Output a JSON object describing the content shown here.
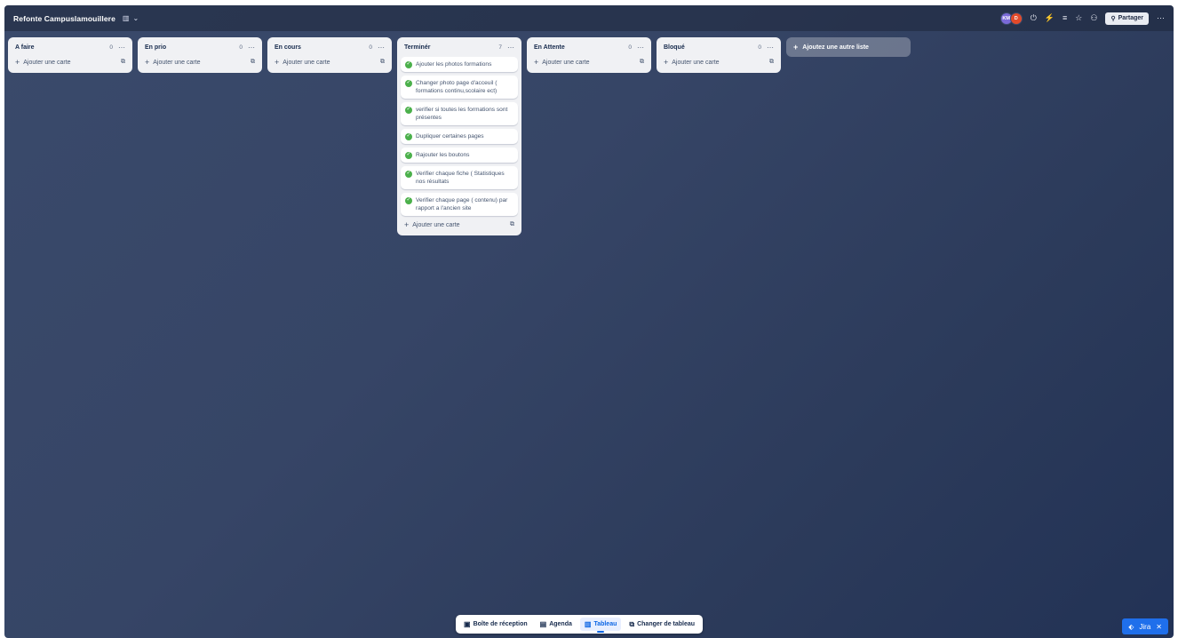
{
  "header": {
    "board_title": "Refonte Campuslamouillere",
    "view_icon": "board-view-icon",
    "avatars": [
      "KM",
      "D"
    ],
    "share_label": "Partager"
  },
  "lists": [
    {
      "title": "A faire",
      "count": "0",
      "add_label": "Ajouter une carte",
      "cards": []
    },
    {
      "title": "En prio",
      "count": "0",
      "add_label": "Ajouter une carte",
      "cards": []
    },
    {
      "title": "En cours",
      "count": "0",
      "add_label": "Ajouter une carte",
      "cards": []
    },
    {
      "title": "Terminér",
      "count": "7",
      "add_label": "Ajouter une carte",
      "cards": [
        "Ajouter les photos formations",
        "Changer photo page d'acceuil ( formations continu,scolaire ect)",
        "verifier si toutes les formations sont présentes",
        "Dupliquer certaines pages",
        "Rajouter les boutons",
        "Verifier chaque fiche ( Statistiques nos résultats",
        "Verifier chaque page ( contenu) par rapport a l'ancien site"
      ]
    },
    {
      "title": "En Attente",
      "count": "0",
      "add_label": "Ajouter une carte",
      "cards": []
    },
    {
      "title": "Bloqué",
      "count": "0",
      "add_label": "Ajouter une carte",
      "cards": []
    }
  ],
  "add_list_label": "Ajoutez une autre liste",
  "switcher": {
    "items": [
      {
        "label": "Boîte de réception",
        "icon": "inbox-icon",
        "active": false
      },
      {
        "label": "Agenda",
        "icon": "calendar-icon",
        "active": false
      },
      {
        "label": "Tableau",
        "icon": "board-icon",
        "active": true
      },
      {
        "label": "Changer de tableau",
        "icon": "switch-board-icon",
        "active": false
      }
    ]
  },
  "jira": {
    "label": "Jira"
  },
  "colors": {
    "background": "#364566",
    "list_bg": "#f0f1f4",
    "check_green": "#4bb04b",
    "accent_blue": "#0c66e4",
    "jira_blue": "#1f6feb"
  }
}
